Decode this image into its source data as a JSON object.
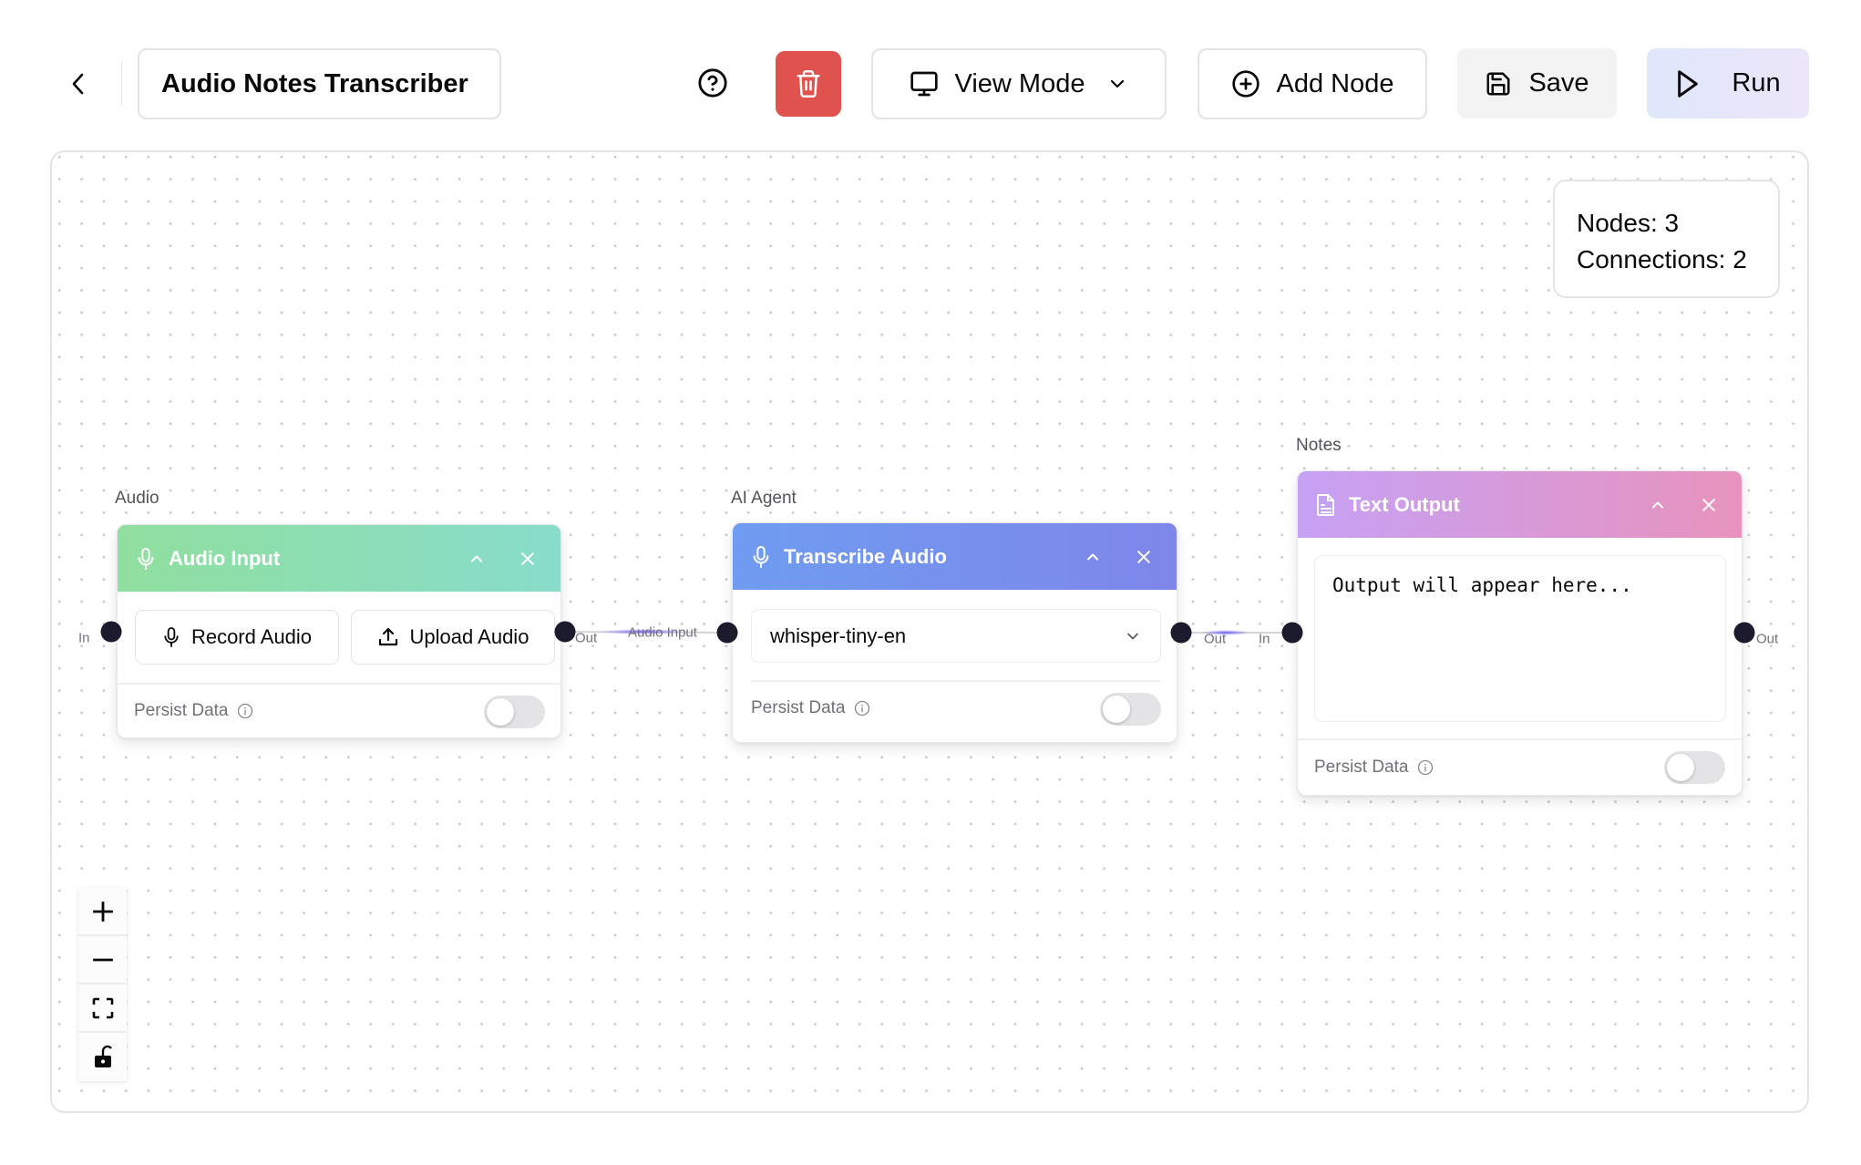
{
  "header": {
    "back_icon": "chevron-left-icon",
    "title": "Audio Notes Transcriber",
    "help_icon": "help-circle-icon",
    "delete_icon": "trash-icon",
    "view_mode_label": "View Mode",
    "add_node_label": "Add Node",
    "save_label": "Save",
    "run_label": "Run"
  },
  "stats": {
    "nodes": "Nodes: 3",
    "connections": "Connections: 2"
  },
  "colors": {
    "delete": "#e0524d",
    "audio_header": [
      "#90df9f",
      "#88dcca"
    ],
    "agent_header": [
      "#6f9cf1",
      "#7e86ea"
    ],
    "output_header": [
      "#c6a1f5",
      "#e893bd"
    ],
    "handle": "#1c1b2e"
  },
  "nodes": [
    {
      "group": "Audio",
      "title": "Audio Input",
      "icon": "microphone-icon",
      "buttons": [
        {
          "label": "Record Audio",
          "icon": "microphone-icon"
        },
        {
          "label": "Upload Audio",
          "icon": "upload-icon"
        }
      ],
      "persist_label": "Persist Data",
      "persist_on": false,
      "in_label": "In",
      "out_label": "Out"
    },
    {
      "group": "AI Agent",
      "title": "Transcribe Audio",
      "icon": "microphone-icon",
      "model": "whisper-tiny-en",
      "persist_label": "Persist Data",
      "persist_on": false,
      "in_label": "Audio Input",
      "out_label": "Out"
    },
    {
      "group": "Notes",
      "title": "Text Output",
      "icon": "document-icon",
      "output_placeholder": "Output will appear here...",
      "persist_label": "Persist Data",
      "persist_on": false,
      "in_label": "In",
      "out_label": "Out"
    }
  ],
  "edges": [
    {
      "from": "Audio Input",
      "to": "Transcribe Audio"
    },
    {
      "from": "Transcribe Audio",
      "to": "Text Output"
    }
  ],
  "controls": [
    "zoom-in",
    "zoom-out",
    "fit-view",
    "lock"
  ]
}
